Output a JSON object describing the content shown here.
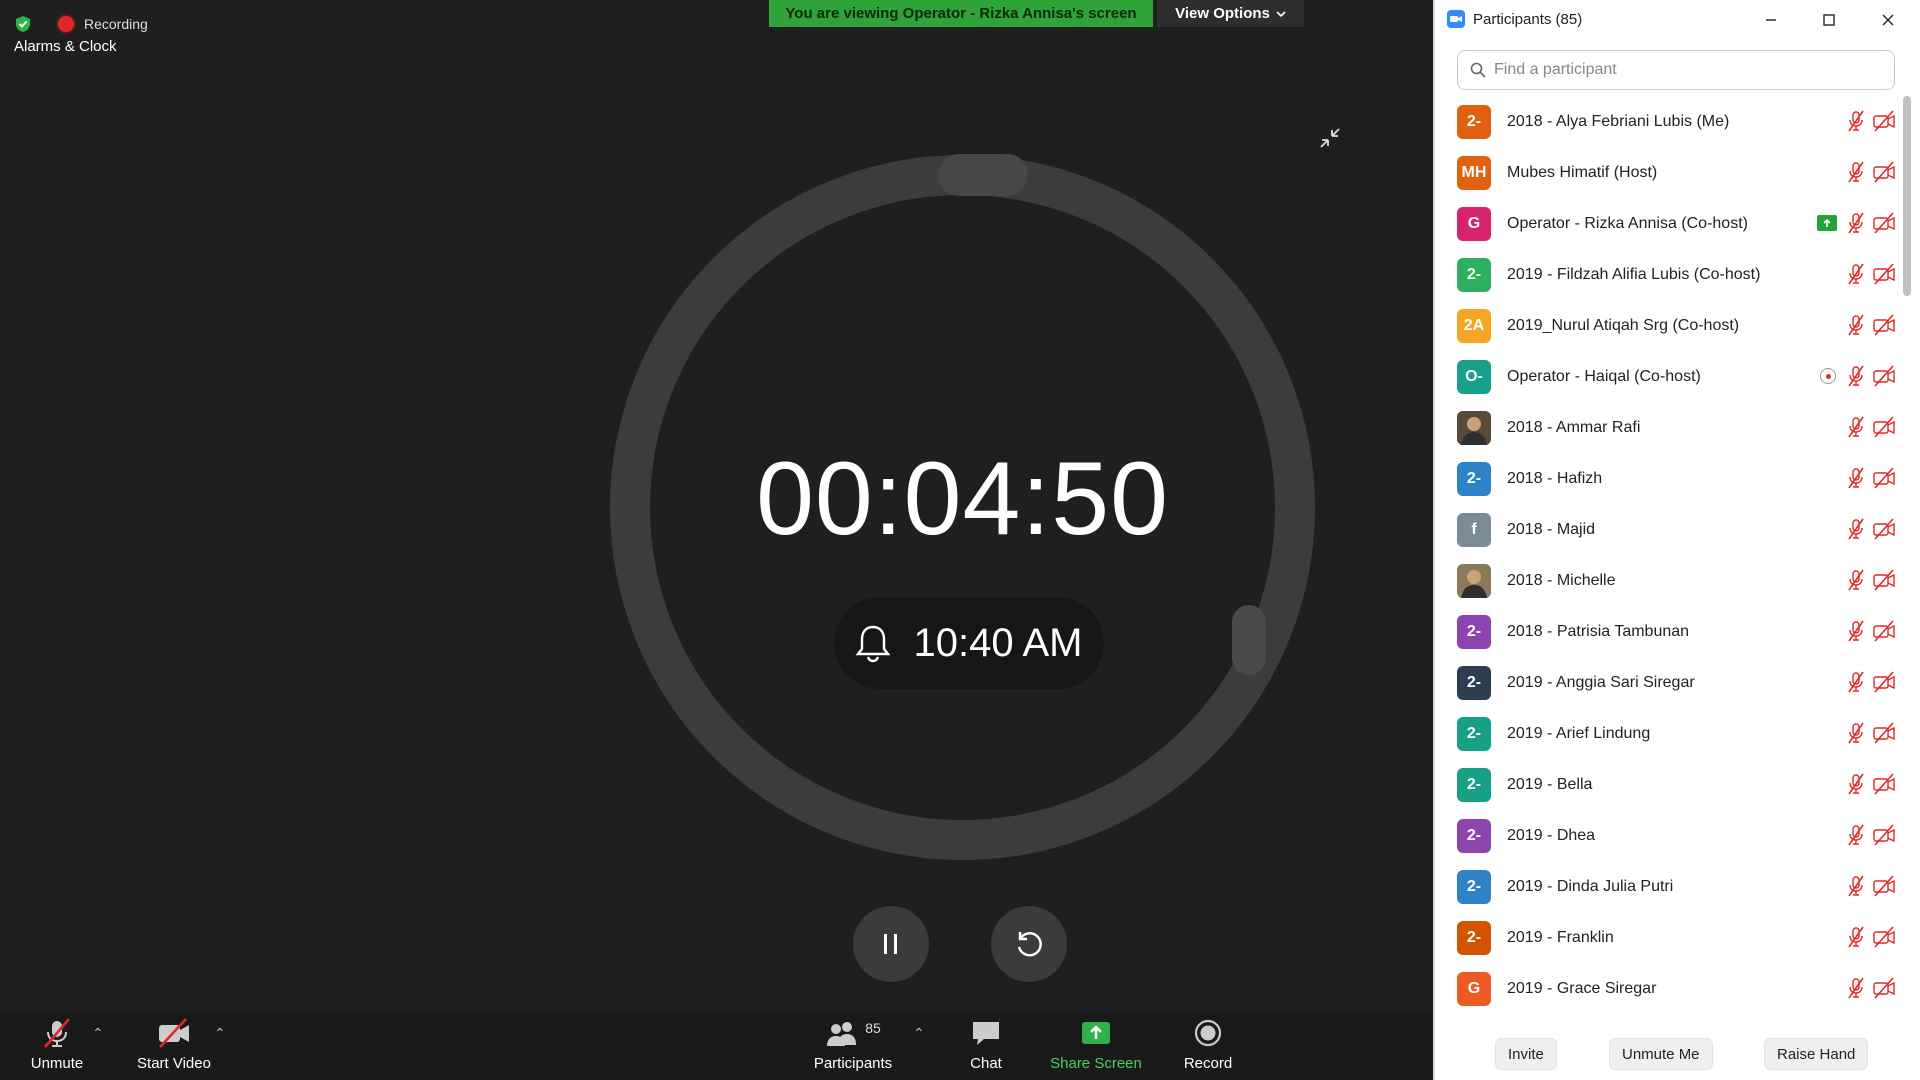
{
  "meeting": {
    "app_title": "Alarms & Clock",
    "recording_label": "Recording",
    "banner_text": "You are viewing Operator - Rizka Annisa's screen",
    "view_options_label": "View Options",
    "timer_value": "00:04:50",
    "alarm_time": "10:40 AM"
  },
  "toolbar": {
    "unmute_label": "Unmute",
    "start_video_label": "Start Video",
    "participants_label": "Participants",
    "participants_count": "85",
    "chat_label": "Chat",
    "share_label": "Share Screen",
    "record_label": "Record"
  },
  "panel": {
    "title": "Participants (85)",
    "search_placeholder": "Find a participant",
    "invite_label": "Invite",
    "unmute_me_label": "Unmute Me",
    "raise_hand_label": "Raise Hand",
    "participants": [
      {
        "initials": "2-",
        "color": "#e0620f",
        "name": "2018 - Alya Febriani Lubis (Me)",
        "indicator": ""
      },
      {
        "initials": "MH",
        "color": "#e0620f",
        "name": "Mubes Himatif (Host)",
        "indicator": ""
      },
      {
        "initials": "G",
        "color": "#d6236a",
        "name": "Operator - Rizka Annisa (Co-host)",
        "indicator": "share"
      },
      {
        "initials": "2-",
        "color": "#2eb05e",
        "name": "2019 - Fildzah Alifia Lubis (Co-host)",
        "indicator": ""
      },
      {
        "initials": "2A",
        "color": "#f5a623",
        "name": "2019_Nurul Atiqah Srg (Co-host)",
        "indicator": ""
      },
      {
        "initials": "O-",
        "color": "#19a08a",
        "name": "Operator - Haiqal (Co-host)",
        "indicator": "pin"
      },
      {
        "initials": "",
        "color": "#5a4a3a",
        "name": "2018 - Ammar Rafi",
        "indicator": "",
        "photo": true
      },
      {
        "initials": "2-",
        "color": "#2d83c6",
        "name": "2018 - Hafizh",
        "indicator": ""
      },
      {
        "initials": "f",
        "color": "#7d8b99",
        "name": "2018 - Majid",
        "indicator": ""
      },
      {
        "initials": "",
        "color": "#8a7a5a",
        "name": "2018 - Michelle",
        "indicator": "",
        "photo": true
      },
      {
        "initials": "2-",
        "color": "#8e44ad",
        "name": "2018 - Patrisia Tambunan",
        "indicator": ""
      },
      {
        "initials": "2-",
        "color": "#2c3e50",
        "name": "2019 - Anggia Sari Siregar",
        "indicator": ""
      },
      {
        "initials": "2-",
        "color": "#16a085",
        "name": "2019 - Arief Lindung",
        "indicator": ""
      },
      {
        "initials": "2-",
        "color": "#16a085",
        "name": "2019 - Bella",
        "indicator": ""
      },
      {
        "initials": "2-",
        "color": "#8e44ad",
        "name": "2019 - Dhea",
        "indicator": ""
      },
      {
        "initials": "2-",
        "color": "#2d83c6",
        "name": "2019 - Dinda Julia Putri",
        "indicator": ""
      },
      {
        "initials": "2-",
        "color": "#d35400",
        "name": "2019 - Franklin",
        "indicator": ""
      },
      {
        "initials": "G",
        "color": "#ee5a24",
        "name": "2019 - Grace Siregar",
        "indicator": ""
      }
    ]
  }
}
